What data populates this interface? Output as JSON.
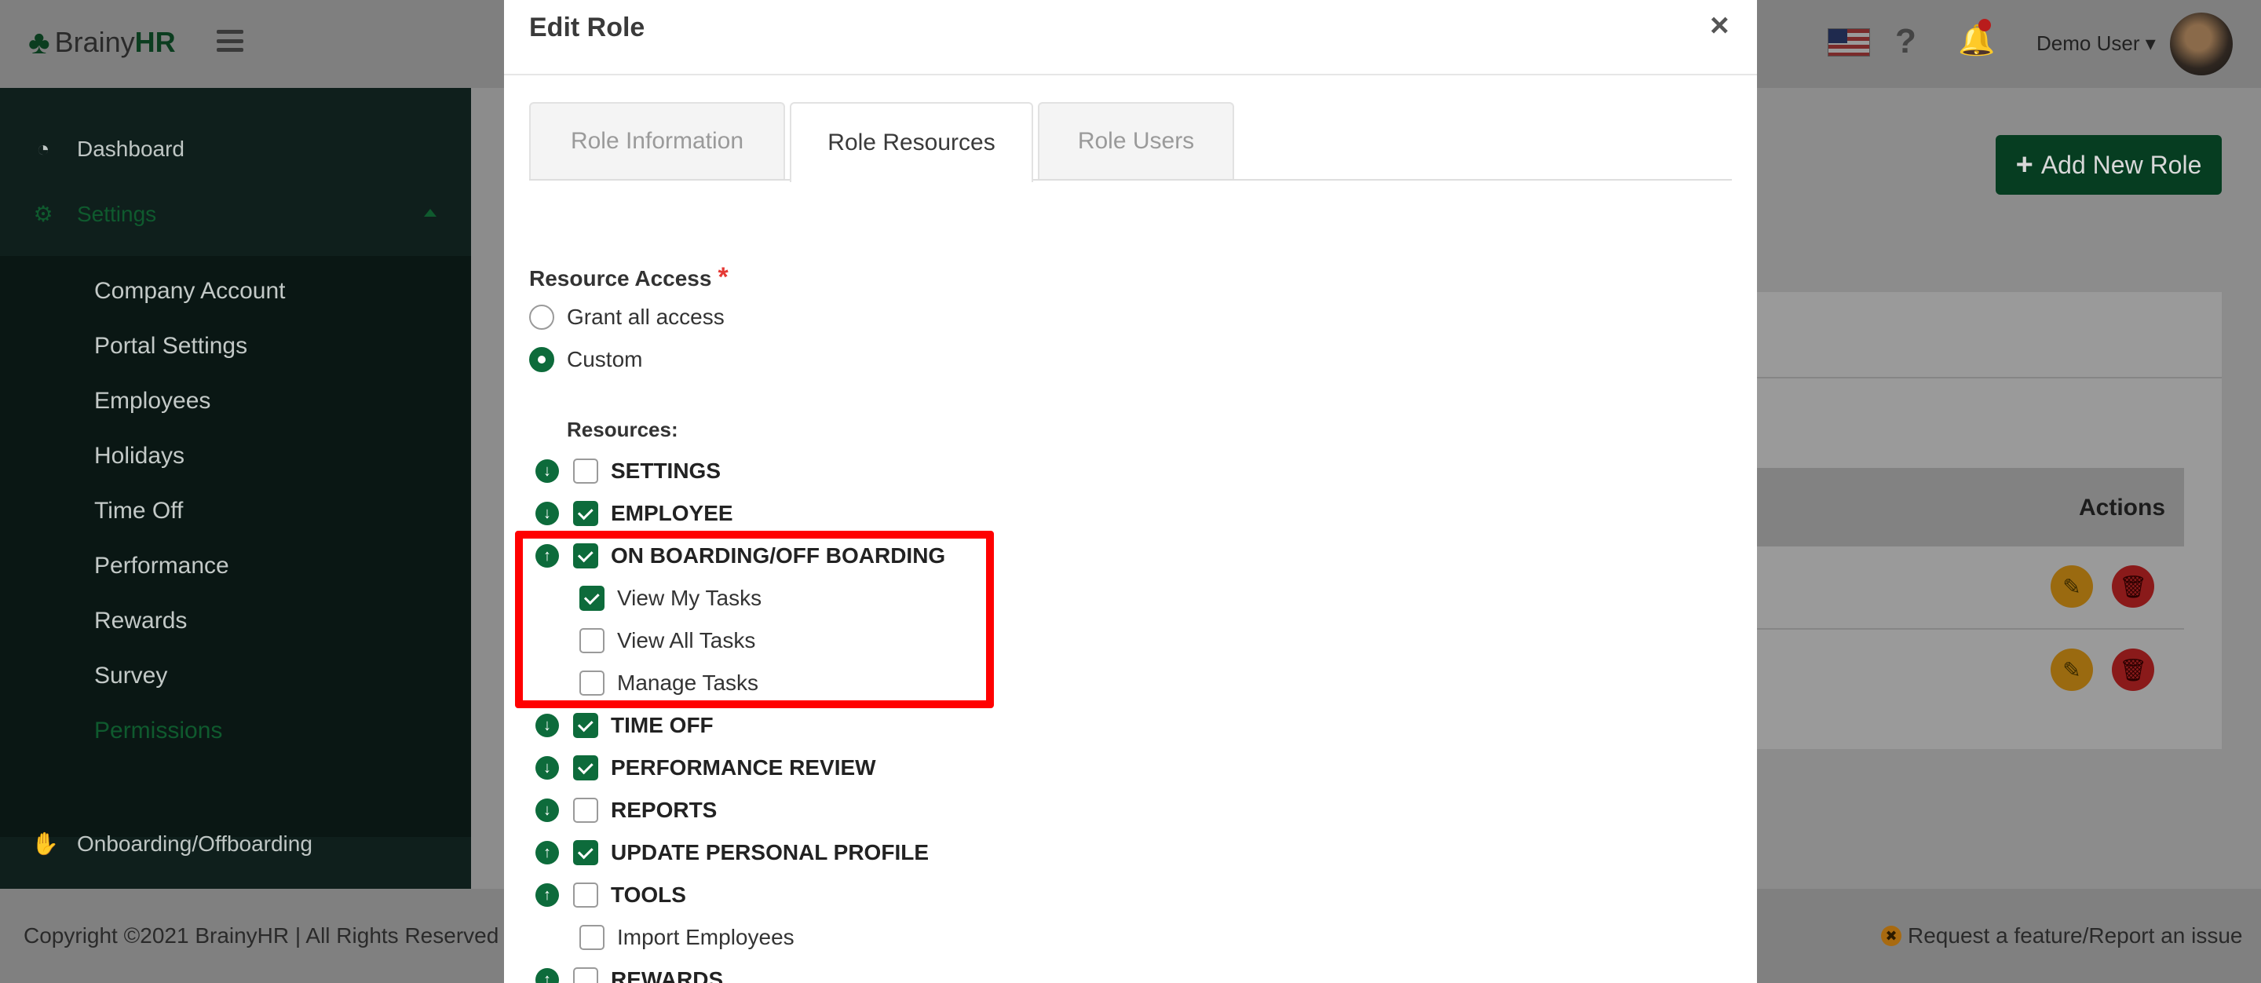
{
  "app": {
    "brand_prefix": "Brainy",
    "brand_suffix": "HR",
    "user_name": "Demo User",
    "clover_icon": "clover-icon",
    "colors": {
      "primary": "#0d6b3b",
      "highlight": "#ff0000",
      "required": "#e53935"
    }
  },
  "sidebar": {
    "dashboard": "Dashboard",
    "settings": "Settings",
    "sub_items": [
      "Company Account",
      "Portal Settings",
      "Employees",
      "Holidays",
      "Time Off",
      "Performance",
      "Rewards",
      "Survey",
      "Permissions"
    ],
    "onboarding": "Onboarding/Offboarding"
  },
  "page": {
    "add_role_label": "Add New Role",
    "actions_header": "Actions"
  },
  "footer": {
    "copyright": "Copyright ©2021 BrainyHR | All Rights Reserved",
    "feature_request": "Request a feature/Report an issue"
  },
  "modal": {
    "title": "Edit Role",
    "close": "×",
    "tabs": [
      {
        "label": "Role Information",
        "active": false
      },
      {
        "label": "Role Resources",
        "active": true
      },
      {
        "label": "Role Users",
        "active": false
      }
    ],
    "resource_access_label": "Resource Access",
    "required_mark": "*",
    "access_options": [
      {
        "label": "Grant all access",
        "selected": false
      },
      {
        "label": "Custom",
        "selected": true
      }
    ],
    "resources_label": "Resources:",
    "resources": [
      {
        "name": "SETTINGS",
        "expand": "down",
        "checked": false
      },
      {
        "name": "EMPLOYEE",
        "expand": "down",
        "checked": true
      },
      {
        "name": "ON BOARDING/OFF BOARDING",
        "expand": "up",
        "checked": true,
        "children": [
          {
            "name": "View My Tasks",
            "checked": true
          },
          {
            "name": "View All Tasks",
            "checked": false
          },
          {
            "name": "Manage Tasks",
            "checked": false
          }
        ]
      },
      {
        "name": "TIME OFF",
        "expand": "down",
        "checked": true
      },
      {
        "name": "PERFORMANCE REVIEW",
        "expand": "down",
        "checked": true
      },
      {
        "name": "REPORTS",
        "expand": "down",
        "checked": false
      },
      {
        "name": "UPDATE PERSONAL PROFILE",
        "expand": "up",
        "checked": true
      },
      {
        "name": "TOOLS",
        "expand": "up",
        "checked": false,
        "children": [
          {
            "name": "Import Employees",
            "checked": false
          }
        ]
      },
      {
        "name": "REWARDS",
        "expand": "up",
        "checked": false
      }
    ]
  }
}
